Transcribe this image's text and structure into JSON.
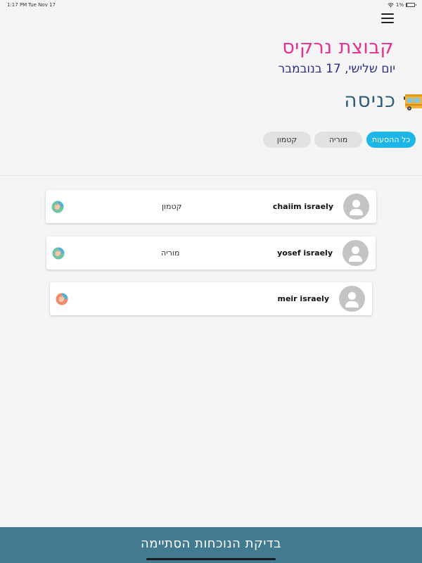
{
  "status": {
    "time": "1:17 PM",
    "date": "Tue Nov 17",
    "battery": "1%",
    "battery_level": 0.01
  },
  "header": {
    "group_title": "קבוצת נרקיס",
    "date_line": "יום שלישי, 17 בנובמבר",
    "section_title": "כניסה",
    "section_icon": "bus-icon",
    "menu_icon": "hamburger-menu-icon"
  },
  "filters": [
    {
      "label": "כל ההסעות",
      "selected": true
    },
    {
      "label": "מוריה",
      "selected": false
    },
    {
      "label": "קטמון",
      "selected": false
    }
  ],
  "passengers": [
    {
      "name": "chaiim israely",
      "station": "קטמון",
      "action_icon": "hand-icon"
    },
    {
      "name": "yosef israely",
      "station": "מוריה",
      "action_icon": "hand-icon"
    },
    {
      "name": "meir israely",
      "station": "",
      "action_icon": "hand-icon"
    }
  ],
  "footer": {
    "finish_label": "בדיקת הנוכחות הסתיימה"
  },
  "colors": {
    "title_pink": "#e8308f",
    "date_blue": "#2a2f8a",
    "section_teal": "#2d5f7a",
    "chip_selected": "#1cb7e8",
    "footer_bar": "#427a92"
  }
}
